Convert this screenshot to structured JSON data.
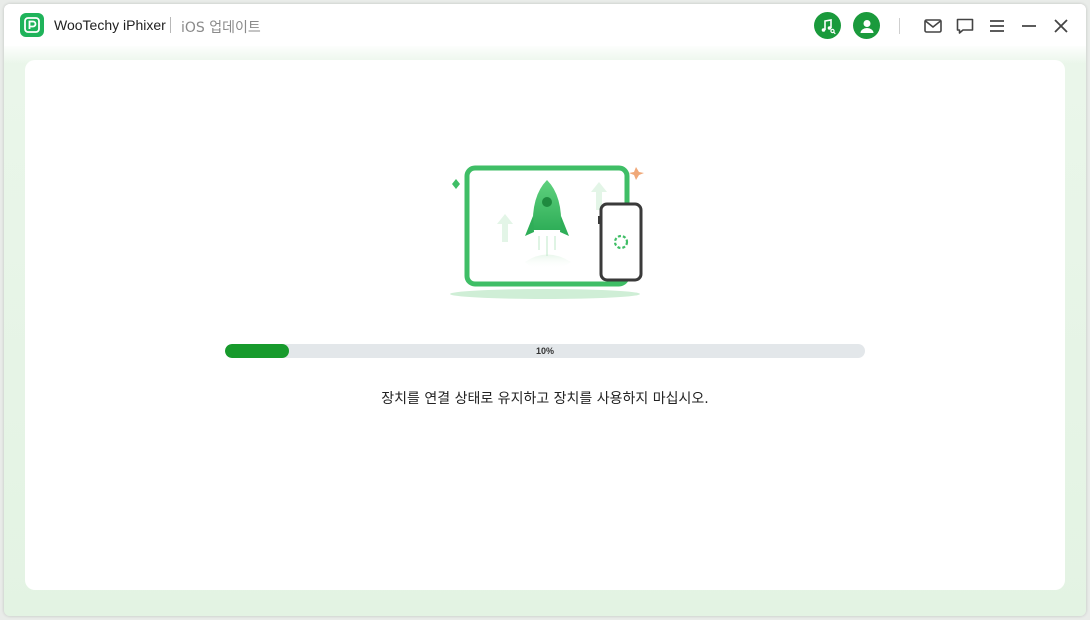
{
  "app": {
    "name": "WooTechy iPhixer",
    "section": "iOS 업데이트"
  },
  "titlebar": {
    "icons": [
      "music-search-icon",
      "account-icon",
      "mail-icon",
      "feedback-icon",
      "menu-icon",
      "minimize-icon",
      "close-icon"
    ]
  },
  "progress": {
    "value": 0.1,
    "label": "10%"
  },
  "status": {
    "message": "장치를 연결 상태로 유지하고 장치를 사용하지 마십시오."
  },
  "colors": {
    "accent": "#179a2c",
    "track": "#e3e7ea",
    "logo": "#1fb35a"
  }
}
